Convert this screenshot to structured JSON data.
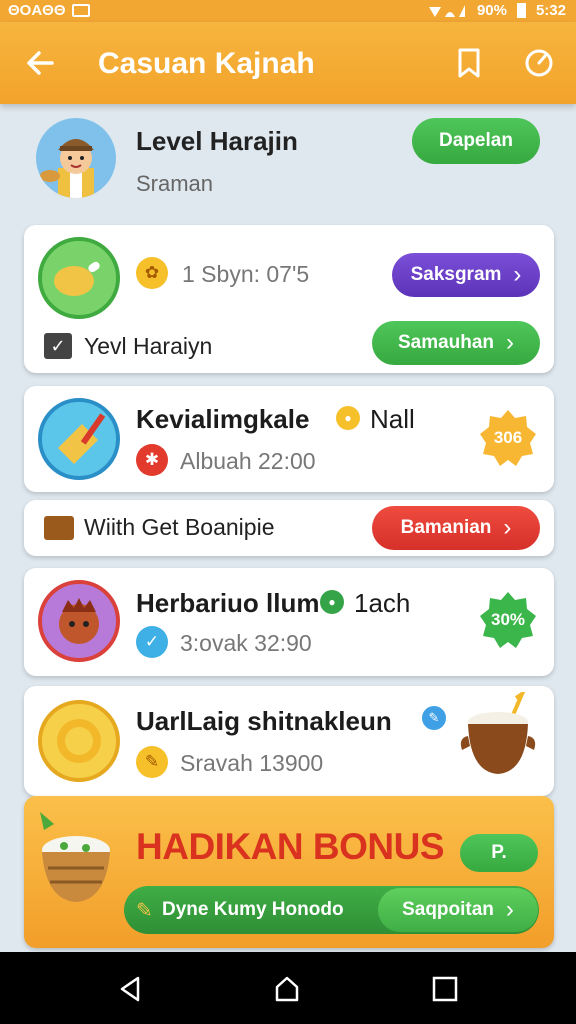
{
  "status_bar": {
    "left_text": "ΘOAΘΘ",
    "battery": "90%",
    "time": "5:32"
  },
  "app_bar": {
    "title": "Casuan Kajnah",
    "back_icon": "back-arrow-icon",
    "bookmark_icon": "bookmark-icon",
    "timer_icon": "timer-icon"
  },
  "profile": {
    "name": "Level Harajin",
    "subtitle": "Sraman",
    "button": "Dapelan"
  },
  "cards": [
    {
      "meta": "1 Sbyn: 07'5",
      "button": "Saksgram",
      "sub_label": "Yevl Haraiyn",
      "sub_button": "Samauhan"
    },
    {
      "title": "Kevialimgkale",
      "title_suffix": "Nall",
      "meta": "Albuah 22:00",
      "badge": "306",
      "sub_label": "Wiith Get Boanipie",
      "sub_button": "Bamanian"
    },
    {
      "title": "Herbariuo llum",
      "title_suffix": "1ach",
      "meta": "3:ovak 32:90",
      "badge": "30%"
    },
    {
      "title": "UarlLaig shitnakleun",
      "meta": "Sravah 13900"
    }
  ],
  "bonus": {
    "title": "HADIKAN BONUS",
    "pill": "P.",
    "bar_label": "Dyne Kumy Honodo",
    "bar_button": "Saqpoitan"
  },
  "colors": {
    "accent": "#f3a32b",
    "green": "#36a93f",
    "purple": "#5c33b8",
    "red": "#d6302a"
  }
}
